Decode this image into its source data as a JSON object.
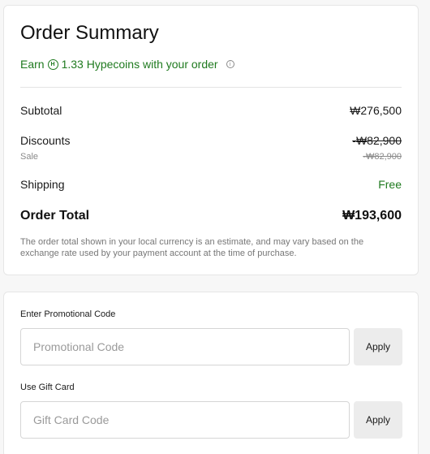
{
  "summary": {
    "title": "Order Summary",
    "earn": {
      "prefix": "Earn",
      "coin_icon": "hypecoin-icon",
      "coin_glyph": "H",
      "text": "1.33 Hypecoins with your order",
      "info_icon": "info-icon"
    },
    "rows": {
      "subtotal": {
        "label": "Subtotal",
        "value": "₩276,500"
      },
      "discounts": {
        "label": "Discounts",
        "value": "-₩82,900"
      },
      "sale": {
        "label": "Sale",
        "value": "-₩82,900"
      },
      "shipping": {
        "label": "Shipping",
        "value": "Free"
      },
      "total": {
        "label": "Order Total",
        "value": "₩193,600"
      }
    },
    "note": "The order total shown in your local currency is an estimate, and may vary based on the exchange rate used by your payment account at the time of purchase."
  },
  "codes": {
    "promo": {
      "label": "Enter Promotional Code",
      "placeholder": "Promotional Code",
      "value": "",
      "button": "Apply"
    },
    "gift": {
      "label": "Use Gift Card",
      "placeholder": "Gift Card Code",
      "value": "",
      "button": "Apply"
    }
  },
  "colors": {
    "accent_green": "#1f7a1f",
    "muted_text": "#777777"
  }
}
